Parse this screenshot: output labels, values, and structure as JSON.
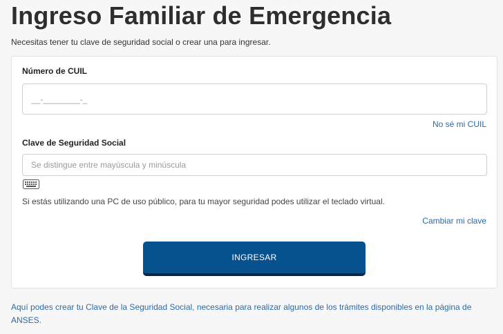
{
  "page": {
    "title": "Ingreso Familiar de Emergencia",
    "subtitle": "Necesitas tener tu clave de seguridad social o crear una para ingresar."
  },
  "form": {
    "cuil": {
      "label": "Número de CUIL",
      "value": "",
      "placeholder": "__-________-_",
      "help_link": "No sé mi CUIL"
    },
    "clave": {
      "label": "Clave de Seguridad Social",
      "value": "",
      "placeholder": "Se distingue entre mayúscula y minúscula",
      "keyboard_icon": "keyboard-icon"
    },
    "hint": "Si estás utilizando una PC de uso público, para tu mayor seguridad podes utilizar el teclado virtual.",
    "change_link": "Cambiar mi clave",
    "submit_label": "INGRESAR"
  },
  "footer": {
    "link": "Aquí podes crear tu Clave de la Seguridad Social, necesaria para realizar algunos de los trámites disponibles en la página de ANSES."
  },
  "colors": {
    "primary_button": "#08518f",
    "link": "#2a6aa8",
    "background": "#f7f7f7"
  }
}
